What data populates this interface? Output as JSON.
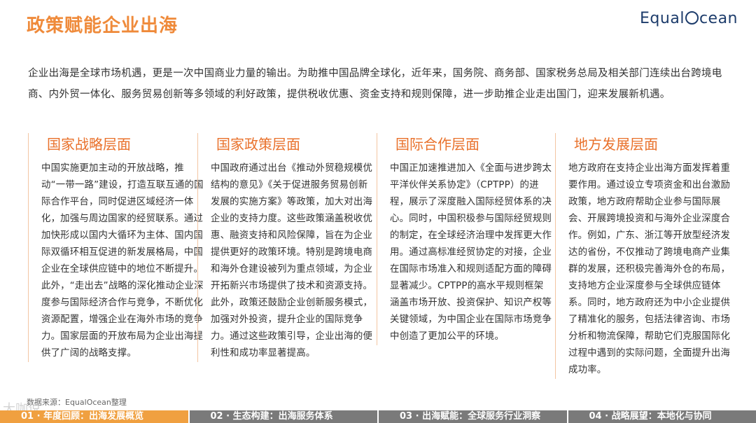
{
  "title": "政策赋能企业出海",
  "logo": {
    "pre": "Equal",
    "post": "cean"
  },
  "intro": "企业出海是全球市场机遇，更是一次中国商业力量的输出。为助推中国品牌全球化，近年来，国务院、商务部、国家税务总局及相关部门连续出台跨境电商、内外贸一体化、服务贸易创新等多领域的利好政策，提供税收优惠、资金支持和规则保障，进一步助推企业走出国门，迎来发展新机遇。",
  "columns": [
    {
      "heading": "国家战略层面",
      "body": "中国实施更加主动的开放战略，推动“一带一路”建设，打造互联互通的国际合作平台，同时促进区域经济一体化，加强与周边国家的经贸联系。通过加快形成以国内大循环为主体、国内国际双循环相互促进的新发展格局，中国企业在全球供应链中的地位不断提升。此外，“走出去”战略的深化推动企业深度参与国际经济合作与竞争，不断优化资源配置，增强企业在海外市场的竞争力。国家层面的开放布局为企业出海提供了广阔的战略支撑。"
    },
    {
      "heading": "国家政策层面",
      "body": "中国政府通过出台《推动外贸稳规模优结构的意见》《关于促进服务贸易创新发展的实施方案》等政策，加大对出海企业的支持力度。这些政策涵盖税收优惠、融资支持和风险保障，旨在为企业提供更好的政策环境。特别是跨境电商和海外仓建设被列为重点领域，为企业开拓新兴市场提供了技术和资源支持。此外，政策还鼓励企业创新服务模式，加强对外投资，提升企业的国际竞争力。通过这些政策引导，企业出海的便利性和成功率显著提高。"
    },
    {
      "heading": "国际合作层面",
      "body": "中国正加速推进加入《全面与进步跨太平洋伙伴关系协定》（CPTPP）的进程，展示了深度融入国际经贸体系的决心。同时，中国积极参与国际经贸规则的制定，在全球经济治理中发挥更大作用。通过高标准经贸协定的对接，企业在国际市场准入和规则适配方面的障碍显著减少。CPTPP的高水平规则框架涵盖市场开放、投资保护、知识产权等关键领域，为中国企业在国际市场竞争中创造了更加公平的环境。"
    },
    {
      "heading": "地方发展层面",
      "body": "地方政府在支持企业出海方面发挥着重要作用。通过设立专项资金和出台激励政策，地方政府帮助企业参与国际展会、开展跨境投资和与海外企业深度合作。例如，广东、浙江等开放型经济发达的省份，不仅推动了跨境电商产业集群的发展，还积极完善海外仓的布局，支持地方企业深度参与全球供应链体系。同时，地方政府还为中小企业提供了精准化的服务，包括法律咨询、市场分析和物流保障，帮助它们克服国际化过程中遇到的实际问题，全面提升出海成功率。"
    }
  ],
  "source": "数据来源：EqualOcean整理",
  "watermark": "大咖说",
  "footer": {
    "tabs": [
      {
        "label": "01 · 年度回顾：出海发展概览",
        "active": true
      },
      {
        "label": "02 · 生态构建：出海服务体系",
        "active": false
      },
      {
        "label": "03 · 出海赋能：全球服务行业洞察",
        "active": false
      },
      {
        "label": "04 · 战略展望：本地化与协同",
        "active": false
      }
    ]
  },
  "colors": {
    "accent": "#e9712b",
    "footer_active": "#f0a040",
    "footer_bg": "#7a7a7a"
  }
}
